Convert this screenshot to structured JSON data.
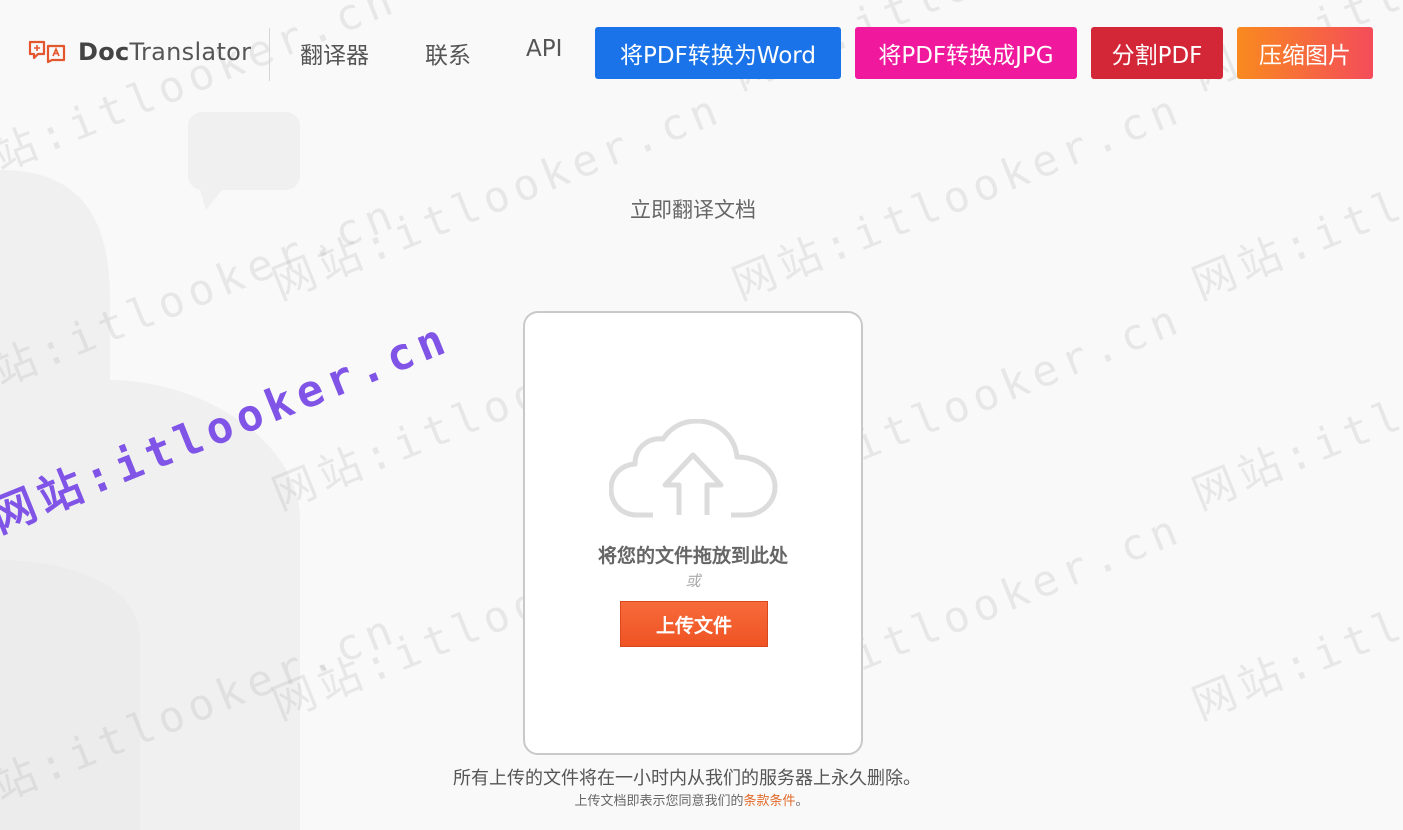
{
  "header": {
    "logo_text_bold": "Doc",
    "logo_text_rest": "Translator",
    "nav_links": [
      "翻译器",
      "联系",
      "API"
    ],
    "nav_buttons": [
      {
        "label": "将PDF转换为Word",
        "color": "#1a73e8"
      },
      {
        "label": "将PDF转换成JPG",
        "color": "#f0189c"
      },
      {
        "label": "分割PDF",
        "color": "#d32637"
      },
      {
        "label": "压缩图片",
        "color_from": "#f98a1f",
        "color_to": "#f44c5a"
      }
    ]
  },
  "main": {
    "title": "立即翻译文档",
    "upload_card": {
      "icon": "cloud-upload-icon",
      "drop_text": "将您的文件拖放到此处",
      "or_text": "或",
      "upload_button": "上传文件"
    },
    "notice": "所有上传的文件将在一小时内从我们的服务器上永久删除。",
    "consent_prefix": "上传文档即表示您同意我们的",
    "terms_link": "条款条件",
    "consent_suffix": "。"
  },
  "watermark": {
    "text": "网站:itlooker.cn",
    "accent_color": "#8054e6"
  }
}
